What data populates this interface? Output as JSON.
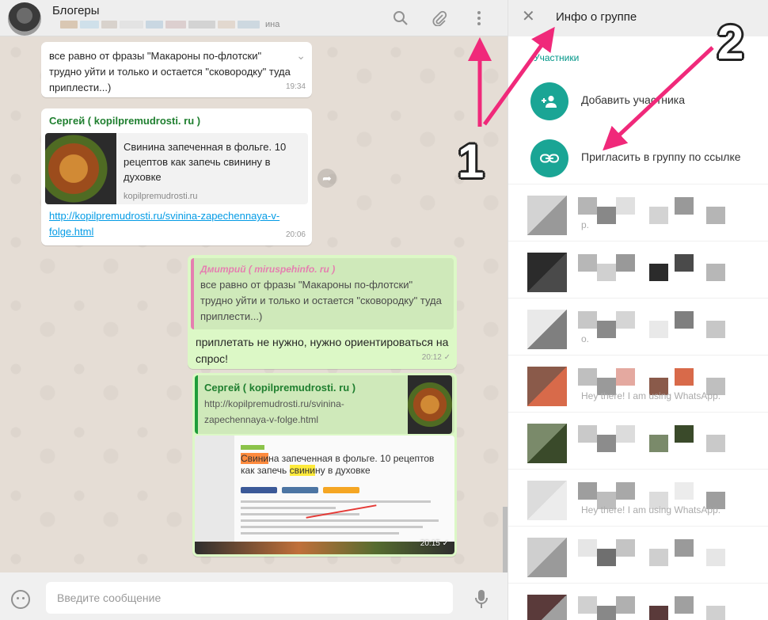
{
  "chat": {
    "title": "Блогеры",
    "members_suffix": "ина",
    "messages": {
      "m1": {
        "text": "все равно от фразы \"Макароны по-флотски\" трудно уйти и только и остается \"сковородку\" туда приплести...)",
        "time": "19:34"
      },
      "m2": {
        "sender": "Сергей ( kopilpremudrosti. ru )",
        "preview_title": "Свинина запеченная в фольге. 10 рецептов как запечь свинину в духовке",
        "preview_domain": "kopilpremudrosti.ru",
        "link": "http://kopilpremudrosti.ru/svinina-zapechennaya-v-folge.html",
        "time": "20:06"
      },
      "m3": {
        "quote_sender": "Дмитрий ( miruspehinfo. ru )",
        "quote_text": "все равно от фразы \"Макароны по-флотски\" трудно уйти и только и остается \"сковородку\" туда приплести...)",
        "text": "приплетать не нужно, нужно ориентироваться на спрос!",
        "time": "20:12"
      },
      "m4": {
        "quote_sender": "Сергей ( kopilpremudrosti. ru )",
        "quote_text": "http://kopilpremudrosti.ru/svinina-zapechennaya-v-folge.html",
        "shot_title_a": "Свини",
        "shot_title_b": "на запеченная в фольге. 10 рецептов как запечь ",
        "shot_title_c": "свини",
        "shot_title_d": "ну в духовке",
        "time": "20:15"
      }
    },
    "input_placeholder": "Введите сообщение"
  },
  "info": {
    "title": "Инфо о группе",
    "section_label": "Участники",
    "add_member": "Добавить участника",
    "invite_link": "Пригласить в группу по ссылке",
    "members": [
      {
        "status": "р."
      },
      {
        "status": ""
      },
      {
        "status": "о."
      },
      {
        "status": "Hey there! I am using WhatsApp."
      },
      {
        "status": ""
      },
      {
        "status": "Hey there! I am using WhatsApp."
      },
      {
        "status": ""
      },
      {
        "status": ""
      }
    ]
  },
  "annotations": {
    "one": "1",
    "two": "2"
  },
  "colors": {
    "accent": "#1aa595",
    "arrow": "#f0297a",
    "outgoing": "#dcf8c6"
  }
}
